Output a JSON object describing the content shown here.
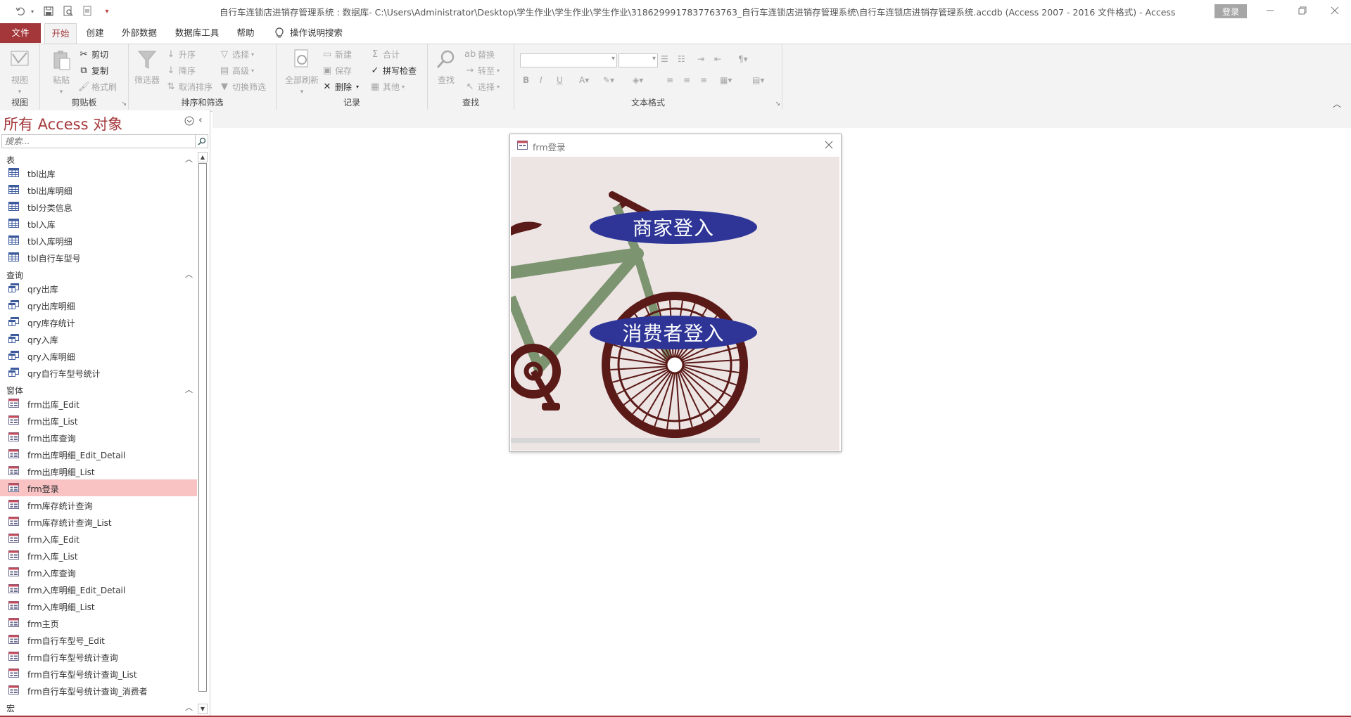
{
  "window": {
    "title": "自行车连锁店进销存管理系统 : 数据库- C:\\Users\\Administrator\\Desktop\\学生作业\\学生作业\\学生作业\\3186299917837763763_自行车连锁店进销存管理系统\\自行车连锁店进销存管理系统.accdb (Access 2007 - 2016 文件格式)  -  Access",
    "signin_label": "登录"
  },
  "tabs": [
    "文件",
    "开始",
    "创建",
    "外部数据",
    "数据库工具",
    "帮助"
  ],
  "tell_me": "操作说明搜索",
  "ribbon": {
    "view": {
      "label": "视图",
      "group": "视图"
    },
    "clipboard": {
      "paste": "粘贴",
      "cut": "剪切",
      "copy": "复制",
      "format_painter": "格式刷",
      "group": "剪贴板"
    },
    "sort_filter": {
      "filter": "筛选器",
      "asc": "升序",
      "desc": "降序",
      "clear_sort": "取消排序",
      "selection": "选择",
      "advanced": "高级",
      "toggle_filter": "切换筛选",
      "group": "排序和筛选"
    },
    "records": {
      "refresh_all": "全部刷新",
      "new": "新建",
      "save": "保存",
      "delete": "删除",
      "totals": "合计",
      "spelling": "拼写检查",
      "more": "其他",
      "group": "记录"
    },
    "find": {
      "find": "查找",
      "replace": "替换",
      "goto": "转至",
      "select": "选择",
      "group": "查找"
    },
    "text_format": {
      "group": "文本格式",
      "bold": "B",
      "italic": "I",
      "underline": "U"
    }
  },
  "nav": {
    "title": "所有 Access 对象",
    "search_placeholder": "搜索...",
    "sections": [
      {
        "label": "表",
        "items": [
          "tbl出库",
          "tbl出库明细",
          "tbl分类信息",
          "tbl入库",
          "tbl入库明细",
          "tbl自行车型号"
        ]
      },
      {
        "label": "查询",
        "items": [
          "qry出库",
          "qry出库明细",
          "qry库存统计",
          "qry入库",
          "qry入库明细",
          "qry自行车型号统计"
        ]
      },
      {
        "label": "窗体",
        "items": [
          "frm出库_Edit",
          "frm出库_List",
          "frm出库查询",
          "frm出库明细_Edit_Detail",
          "frm出库明细_List",
          "frm登录",
          "frm库存统计查询",
          "frm库存统计查询_List",
          "frm入库_Edit",
          "frm入库_List",
          "frm入库查询",
          "frm入库明细_Edit_Detail",
          "frm入库明细_List",
          "frm主页",
          "frm自行车型号_Edit",
          "frm自行车型号统计查询",
          "frm自行车型号统计查询_List",
          "frm自行车型号统计查询_消费者"
        ]
      },
      {
        "label": "宏",
        "items": []
      }
    ],
    "selected": "frm登录"
  },
  "form": {
    "title": "frm登录",
    "merchant_login": "商家登入",
    "consumer_login": "消费者登入"
  },
  "colors": {
    "accent": "#a4373a",
    "selected_item": "#f9c2c3",
    "login_button": "#2e3597",
    "form_background": "#ede5e4",
    "bike_frame": "#7d9470",
    "bike_wheel": "#5a1a18"
  }
}
